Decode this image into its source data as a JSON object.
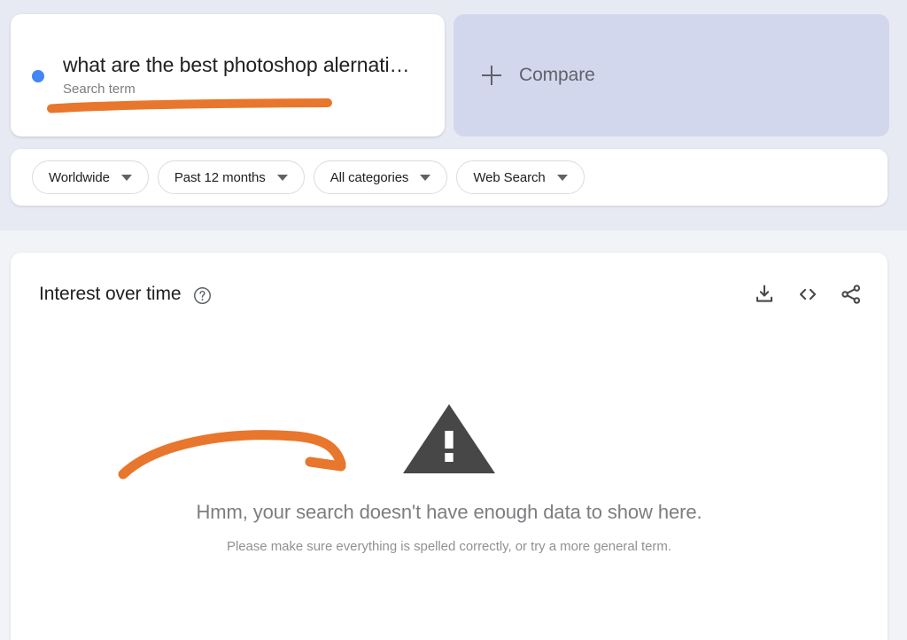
{
  "colors": {
    "band_top": "#e8eaf3",
    "band_bottom": "#f1f3f7",
    "accent_blue": "#4285f4",
    "annotation_orange": "#e8762c",
    "compare_card": "#d3d7ee",
    "warning_gray": "#474747"
  },
  "search": {
    "term": "what are the best photoshop alernati…",
    "subtitle": "Search term",
    "dot_icon": "blue-dot-icon"
  },
  "compare": {
    "label": "Compare",
    "plus_icon": "plus-icon"
  },
  "filters": [
    {
      "label": "Worldwide",
      "caret_icon": "chevron-down-icon"
    },
    {
      "label": "Past 12 months",
      "caret_icon": "chevron-down-icon"
    },
    {
      "label": "All categories",
      "caret_icon": "chevron-down-icon"
    },
    {
      "label": "Web Search",
      "caret_icon": "chevron-down-icon"
    }
  ],
  "chart_panel": {
    "title": "Interest over time",
    "help_icon": "help-circle-icon",
    "actions": [
      {
        "name": "download-icon",
        "label": "Download"
      },
      {
        "name": "embed-code-icon",
        "label": "Embed"
      },
      {
        "name": "share-icon",
        "label": "Share"
      }
    ],
    "empty_state": {
      "warning_icon": "warning-triangle-icon",
      "title": "Hmm, your search doesn't have enough data to show here.",
      "subtitle": "Please make sure everything is spelled correctly, or try a more general term."
    }
  },
  "annotations": [
    {
      "name": "underline-annotation",
      "shape": "orange-underline-stroke"
    },
    {
      "name": "arrow-annotation",
      "shape": "orange-curved-arrow"
    }
  ]
}
